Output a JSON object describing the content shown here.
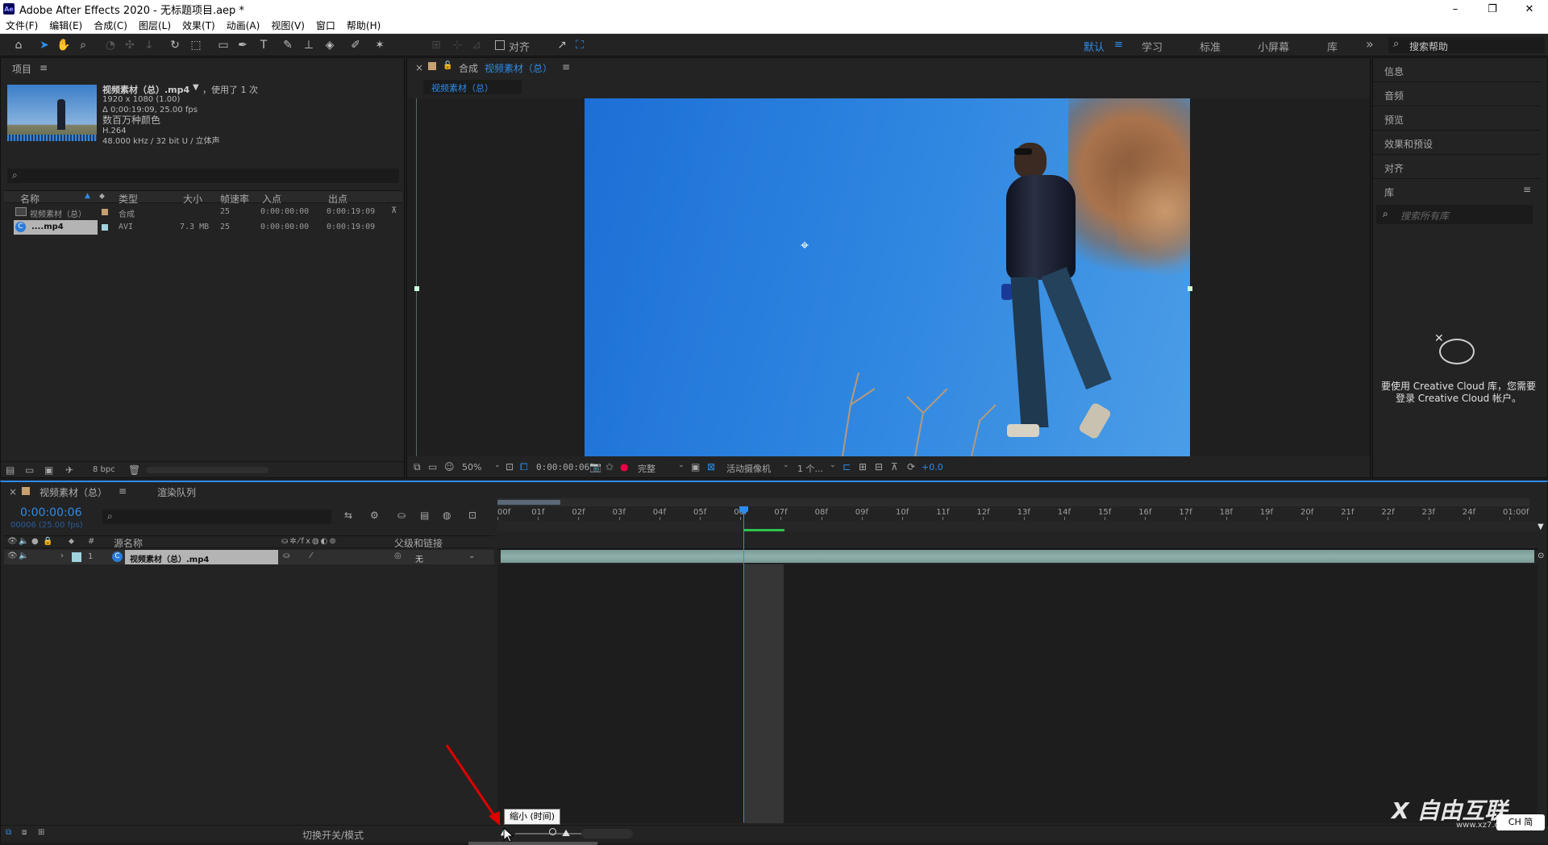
{
  "window": {
    "app_badge": "Ae",
    "title": "Adobe After Effects 2020 - 无标题项目.aep *",
    "minimize": "–",
    "restore": "❐",
    "close": "✕"
  },
  "menu": [
    "文件(F)",
    "编辑(E)",
    "合成(C)",
    "图层(L)",
    "效果(T)",
    "动画(A)",
    "视图(V)",
    "窗口",
    "帮助(H)"
  ],
  "toolbar": {
    "snap_label": "对齐",
    "workspaces": [
      "默认",
      "学习",
      "标准",
      "小屏幕",
      "库"
    ],
    "active_workspace": "默认",
    "more": "»",
    "help_placeholder": "搜索帮助"
  },
  "project": {
    "tab": "项目",
    "menu_icon": "≡",
    "item_name": "视频素材（总）.mp4",
    "item_arrow": "▼",
    "used": "，使用了 1 次",
    "info": [
      "1920 x 1080 (1.00)",
      "Δ 0;00:19:09, 25.00 fps",
      "数百万种颜色",
      "H.264",
      "48.000 kHz / 32 bit U / 立体声"
    ],
    "search_icon": "⌕",
    "columns": [
      "名称",
      "类型",
      "大小",
      "帧速率",
      "入点",
      "出点"
    ],
    "rows": [
      {
        "name": "视频素材（总）",
        "type": "合成",
        "size": "",
        "fps": "25",
        "in": "0:00:00:00",
        "out": "0:00:19:09",
        "color": "#c8a070"
      },
      {
        "name": "....mp4",
        "type": "AVI",
        "size": "7.3 MB",
        "fps": "25",
        "in": "0:00:00:00",
        "out": "0:00:19:09",
        "color": "#9fd4df"
      }
    ],
    "bpc": "8 bpc"
  },
  "composition": {
    "close": "×",
    "tab_prefix": "合成",
    "tab_name": "视频素材（总）",
    "subtab": "视频素材（总）",
    "zoom": "50%",
    "timecode": "0:00:00:06",
    "resolution": "完整",
    "camera": "活动摄像机",
    "views": "1 个...",
    "exposure": "+0.0"
  },
  "right_panel": {
    "items": [
      "信息",
      "音频",
      "预览",
      "效果和预设",
      "对齐",
      "库"
    ],
    "lib_placeholder": "搜索所有库",
    "cc_message": "要使用 Creative Cloud 库，您需要登录 Creative Cloud 帐户。"
  },
  "timeline": {
    "tab": "视频素材（总）",
    "render_queue": "渲染队列",
    "timecode": "0:00:00:06",
    "frames": "00006 (25.00 fps)",
    "layer_cols": [
      "源名称",
      "父级和链接"
    ],
    "layer": {
      "num": "1",
      "name": "视频素材（总）.mp4",
      "parent": "无"
    },
    "ruler": [
      "00f",
      "01f",
      "02f",
      "03f",
      "04f",
      "05f",
      "06f",
      "07f",
      "08f",
      "09f",
      "10f",
      "11f",
      "12f",
      "13f",
      "14f",
      "15f",
      "16f",
      "17f",
      "18f",
      "19f",
      "20f",
      "21f",
      "22f",
      "23f",
      "24f",
      "01:00f"
    ],
    "current_frame": 6,
    "toggle_label": "切换开关/模式",
    "tooltip": "缩小 (时间)"
  },
  "watermark": {
    "brand": "X 自由互联",
    "url": "www.xz7.com"
  },
  "ime": "CH 简",
  "colors": {
    "accent": "#2d8ceb",
    "panel": "#232323",
    "frame": "#1d1d1d",
    "clip": "#8fb0ab",
    "arrow": "#e00000"
  }
}
